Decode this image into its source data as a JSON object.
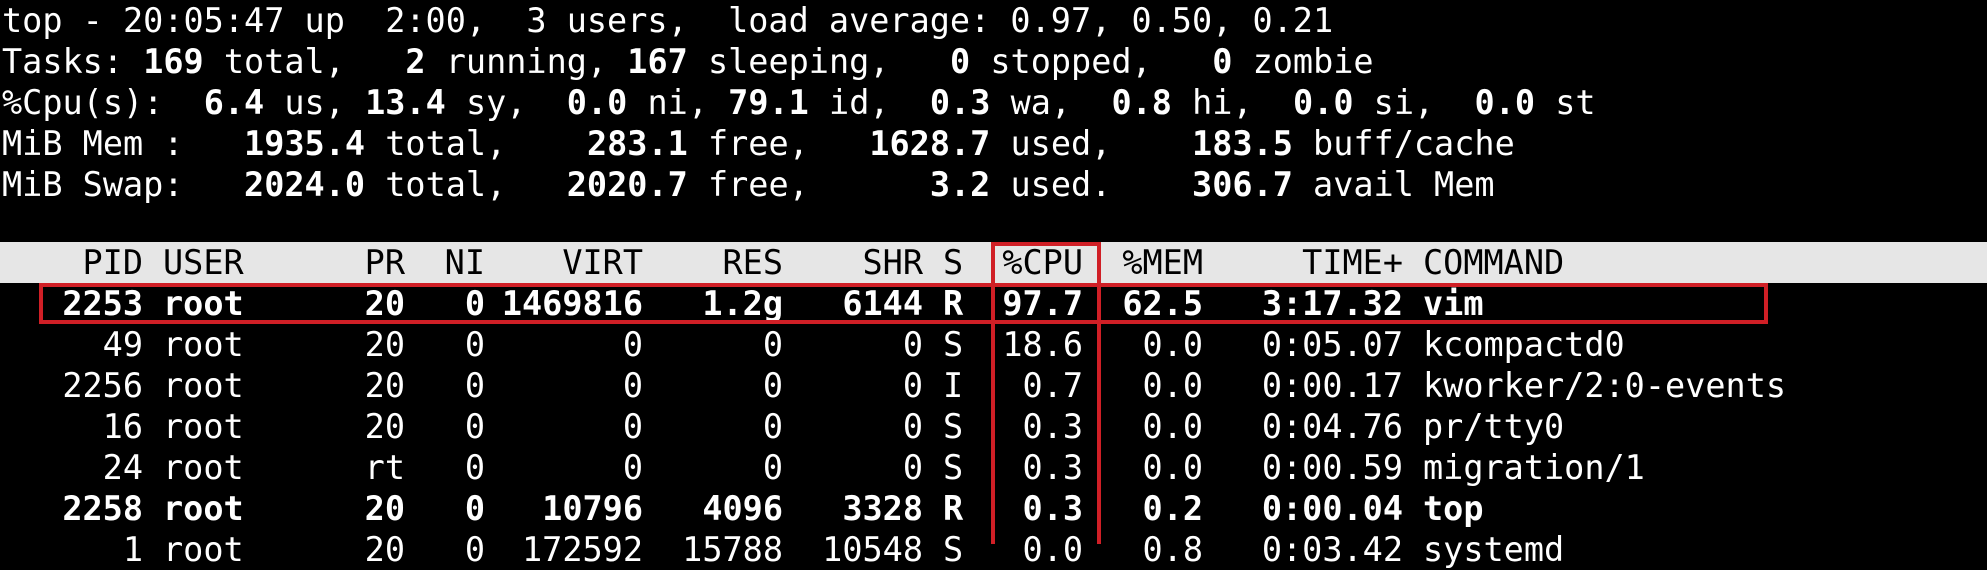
{
  "summary": {
    "line1": "top - 20:05:47 up  2:00,  3 users,  load average: 0.97, 0.50, 0.21",
    "tasks": {
      "label": "Tasks:",
      "total": "169",
      "total_lbl": "total,",
      "running": "2",
      "running_lbl": "running,",
      "sleeping": "167",
      "sleeping_lbl": "sleeping,",
      "stopped": "0",
      "stopped_lbl": "stopped,",
      "zombie": "0",
      "zombie_lbl": "zombie"
    },
    "cpu": {
      "label": "%Cpu(s):",
      "us": "6.4",
      "us_lbl": "us,",
      "sy": "13.4",
      "sy_lbl": "sy,",
      "ni": "0.0",
      "ni_lbl": "ni,",
      "id": "79.1",
      "id_lbl": "id,",
      "wa": "0.3",
      "wa_lbl": "wa,",
      "hi": "0.8",
      "hi_lbl": "hi,",
      "si": "0.0",
      "si_lbl": "si,",
      "st": "0.0",
      "st_lbl": "st"
    },
    "mem": {
      "label": "MiB Mem :",
      "total": "1935.4",
      "total_lbl": "total,",
      "free": "283.1",
      "free_lbl": "free,",
      "used": "1628.7",
      "used_lbl": "used,",
      "cache": "183.5",
      "cache_lbl": "buff/cache"
    },
    "swap": {
      "label": "MiB Swap:",
      "total": "2024.0",
      "total_lbl": "total,",
      "free": "2020.7",
      "free_lbl": "free,",
      "used": "3.2",
      "used_lbl": "used.",
      "avail": "306.7",
      "avail_lbl": "avail Mem"
    }
  },
  "table": {
    "headers": {
      "pid": "PID",
      "user": "USER",
      "pr": "PR",
      "ni": "NI",
      "virt": "VIRT",
      "res": "RES",
      "shr": "SHR",
      "s": "S",
      "cpu": "%CPU",
      "mem": "%MEM",
      "time": "TIME+",
      "command": "COMMAND"
    },
    "rows": [
      {
        "pid": "2253",
        "user": "root",
        "pr": "20",
        "ni": "0",
        "virt": "1469816",
        "res": "1.2g",
        "shr": "6144",
        "s": "R",
        "cpu": "97.7",
        "mem": "62.5",
        "time": "3:17.32",
        "command": "vim"
      },
      {
        "pid": "49",
        "user": "root",
        "pr": "20",
        "ni": "0",
        "virt": "0",
        "res": "0",
        "shr": "0",
        "s": "S",
        "cpu": "18.6",
        "mem": "0.0",
        "time": "0:05.07",
        "command": "kcompactd0"
      },
      {
        "pid": "2256",
        "user": "root",
        "pr": "20",
        "ni": "0",
        "virt": "0",
        "res": "0",
        "shr": "0",
        "s": "I",
        "cpu": "0.7",
        "mem": "0.0",
        "time": "0:00.17",
        "command": "kworker/2:0-events"
      },
      {
        "pid": "16",
        "user": "root",
        "pr": "20",
        "ni": "0",
        "virt": "0",
        "res": "0",
        "shr": "0",
        "s": "S",
        "cpu": "0.3",
        "mem": "0.0",
        "time": "0:04.76",
        "command": "pr/tty0"
      },
      {
        "pid": "24",
        "user": "root",
        "pr": "rt",
        "ni": "0",
        "virt": "0",
        "res": "0",
        "shr": "0",
        "s": "S",
        "cpu": "0.3",
        "mem": "0.0",
        "time": "0:00.59",
        "command": "migration/1"
      },
      {
        "pid": "2258",
        "user": "root",
        "pr": "20",
        "ni": "0",
        "virt": "10796",
        "res": "4096",
        "shr": "3328",
        "s": "R",
        "cpu": "0.3",
        "mem": "0.2",
        "time": "0:00.04",
        "command": "top"
      },
      {
        "pid": "1",
        "user": "root",
        "pr": "20",
        "ni": "0",
        "virt": "172592",
        "res": "15788",
        "shr": "10548",
        "s": "S",
        "cpu": "0.0",
        "mem": "0.8",
        "time": "0:03.42",
        "command": "systemd"
      }
    ]
  },
  "highlights": {
    "color": "#d01f26"
  }
}
